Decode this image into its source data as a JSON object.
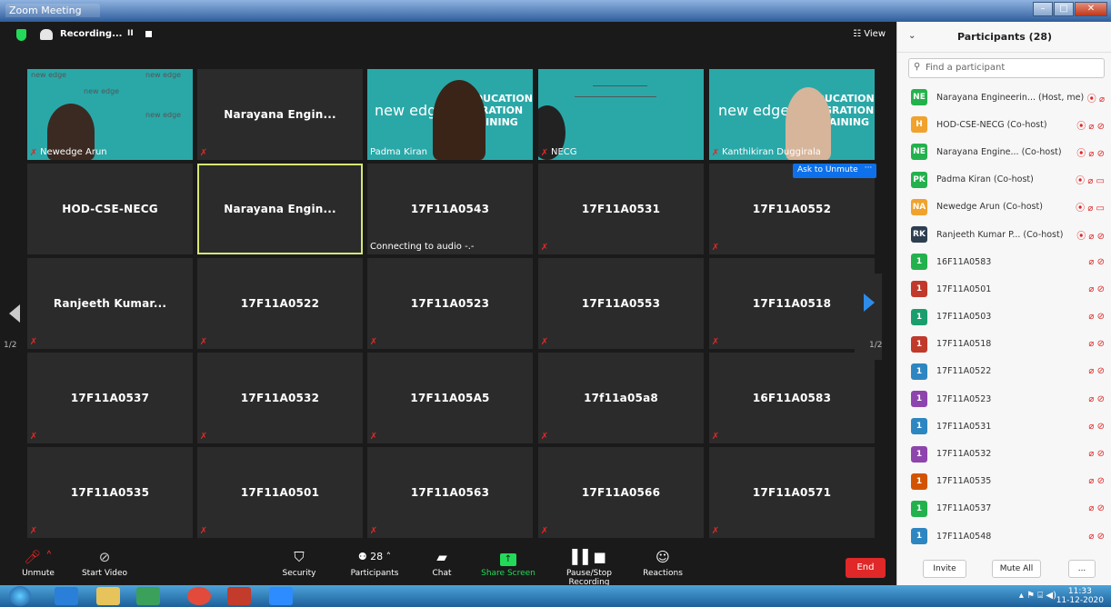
{
  "window": {
    "title": "Zoom Meeting"
  },
  "topbar": {
    "recording_label": "Recording...",
    "pause_symbol": "II",
    "view_label": "☷ View"
  },
  "grid": {
    "row1": [
      {
        "type": "video",
        "caption": "Newedge Arun",
        "brand": "new edge"
      },
      {
        "type": "name",
        "name": "Narayana Engin..."
      },
      {
        "type": "video",
        "caption": "Padma Kiran",
        "brand": "new edge",
        "side": "DUCATION RATION INING"
      },
      {
        "type": "video",
        "caption": "NECG"
      },
      {
        "type": "video",
        "caption": "Kanthikiran Duggirala",
        "brand": "new edge",
        "side": "EDUCATION MIGRATION TRAINING"
      }
    ],
    "row2": [
      "HOD-CSE-NECG",
      "Narayana Engin...",
      "17F11A0543",
      "17F11A0531",
      "17F11A0552"
    ],
    "row3": [
      "Ranjeeth Kumar...",
      "17F11A0522",
      "17F11A0523",
      "17F11A0553",
      "17F11A0518"
    ],
    "row4": [
      "17F11A0537",
      "17F11A0532",
      "17F11A05A5",
      "17f11a05a8",
      "16F11A0583"
    ],
    "row5": [
      "17F11A0535",
      "17F11A0501",
      "17F11A0563",
      "17F11A0566",
      "17F11A0571"
    ],
    "connecting_text": "Connecting to audio -.-",
    "ask_unmute": "Ask to Unmute",
    "more": "···"
  },
  "nav": {
    "page_left": "1/2",
    "page_right": "1/2"
  },
  "toolbar": {
    "unmute": "Unmute",
    "start_video": "Start Video",
    "security": "Security",
    "participants": "Participants",
    "participants_count": "28",
    "chat": "Chat",
    "share_screen": "Share Screen",
    "recording": "Pause/Stop Recording",
    "reactions": "Reactions",
    "end": "End"
  },
  "panel": {
    "title": "Participants (28)",
    "search_placeholder": "Find a participant",
    "participants": [
      {
        "initials": "NE",
        "color": "#23b14d",
        "name": "Narayana Engineerin... (Host, me)",
        "icons": "⦿ ⌀"
      },
      {
        "initials": "H",
        "color": "#f0a22c",
        "name": "HOD-CSE-NECG (Co-host)",
        "icons": "⦿ ⌀ ⊘"
      },
      {
        "initials": "NE",
        "color": "#23b14d",
        "name": "Narayana Engine... (Co-host)",
        "icons": "⦿ ⌀ ⊘"
      },
      {
        "initials": "PK",
        "color": "#23b14d",
        "name": "Padma Kiran (Co-host)",
        "icons": "⦿ ⌀ ▭"
      },
      {
        "initials": "NA",
        "color": "#f0a22c",
        "name": "Newedge Arun (Co-host)",
        "icons": "⦿ ⌀ ▭"
      },
      {
        "initials": "RK",
        "color": "#2d3e50",
        "name": "Ranjeeth Kumar P... (Co-host)",
        "icons": "⦿ ⌀ ⊘"
      },
      {
        "initials": "1",
        "color": "#23b14d",
        "name": "16F11A0583",
        "icons": "⌀ ⊘"
      },
      {
        "initials": "1",
        "color": "#c0392b",
        "name": "17F11A0501",
        "icons": "⌀ ⊘"
      },
      {
        "initials": "1",
        "color": "#1a9e6e",
        "name": "17F11A0503",
        "icons": "⌀ ⊘"
      },
      {
        "initials": "1",
        "color": "#c0392b",
        "name": "17F11A0518",
        "icons": "⌀ ⊘"
      },
      {
        "initials": "1",
        "color": "#2e86c1",
        "name": "17F11A0522",
        "icons": "⌀ ⊘"
      },
      {
        "initials": "1",
        "color": "#8e44ad",
        "name": "17F11A0523",
        "icons": "⌀ ⊘"
      },
      {
        "initials": "1",
        "color": "#2e86c1",
        "name": "17F11A0531",
        "icons": "⌀ ⊘"
      },
      {
        "initials": "1",
        "color": "#8e44ad",
        "name": "17F11A0532",
        "icons": "⌀ ⊘"
      },
      {
        "initials": "1",
        "color": "#d35400",
        "name": "17F11A0535",
        "icons": "⌀ ⊘"
      },
      {
        "initials": "1",
        "color": "#23b14d",
        "name": "17F11A0537",
        "icons": "⌀ ⊘"
      },
      {
        "initials": "1",
        "color": "#2e86c1",
        "name": "17F11A0548",
        "icons": "⌀ ⊘"
      }
    ],
    "invite": "Invite",
    "mute_all": "Mute All",
    "more": "..."
  },
  "taskbar": {
    "time": "11:33",
    "date": "11-12-2020"
  }
}
